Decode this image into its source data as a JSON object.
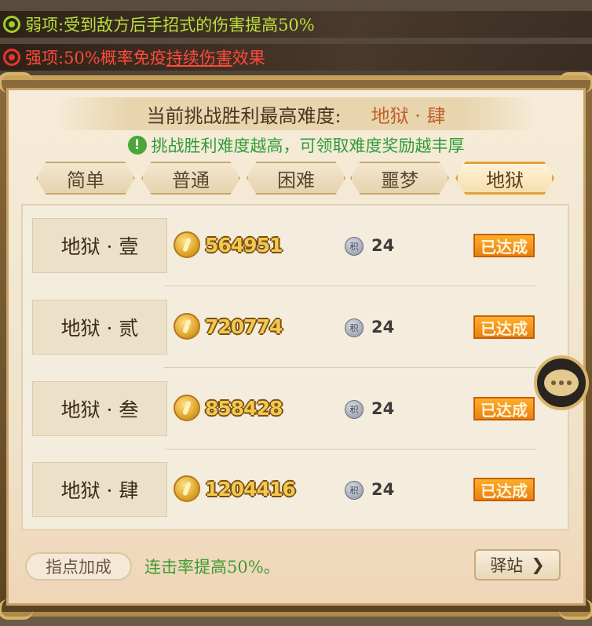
{
  "buffs": {
    "weak": {
      "label": "弱项:受到敌方后手招式的伤害提高50%"
    },
    "strong": {
      "prefix": "强项:50%概率免疫",
      "highlight": "持续伤害",
      "suffix": "效果"
    }
  },
  "header": {
    "label": "当前挑战胜利最高难度:",
    "value": "地狱 · 肆",
    "hint": "挑战胜利难度越高，可领取难度奖励越丰厚",
    "info_icon": "!"
  },
  "tabs": [
    {
      "label": "简单"
    },
    {
      "label": "普通"
    },
    {
      "label": "困难"
    },
    {
      "label": "噩梦"
    },
    {
      "label": "地狱",
      "active": true
    }
  ],
  "levels": [
    {
      "name": "地狱 · 壹",
      "coins": "564951",
      "points": "24",
      "status": "已达成"
    },
    {
      "name": "地狱 · 贰",
      "coins": "720774",
      "points": "24",
      "status": "已达成"
    },
    {
      "name": "地狱 · 叁",
      "coins": "858428",
      "points": "24",
      "status": "已达成"
    },
    {
      "name": "地狱 · 肆",
      "coins": "1204416",
      "points": "24",
      "status": "已达成"
    }
  ],
  "points_icon_glyph": "积",
  "footer": {
    "bonus_label": "指点加成",
    "bonus_text": "连击率提高50%。",
    "station_button": "驿站",
    "station_arrow": "❯"
  },
  "colors": {
    "weak": "#b9e03c",
    "strong": "#ff4a3c",
    "hint_green": "#2f9d3a",
    "badge_orange": "#ea7f12",
    "coin_gold": "#f2c94c"
  },
  "icons": [
    "target-icon",
    "info-icon",
    "coin-icon",
    "points-icon",
    "chat-icon",
    "chevron-right-icon"
  ]
}
